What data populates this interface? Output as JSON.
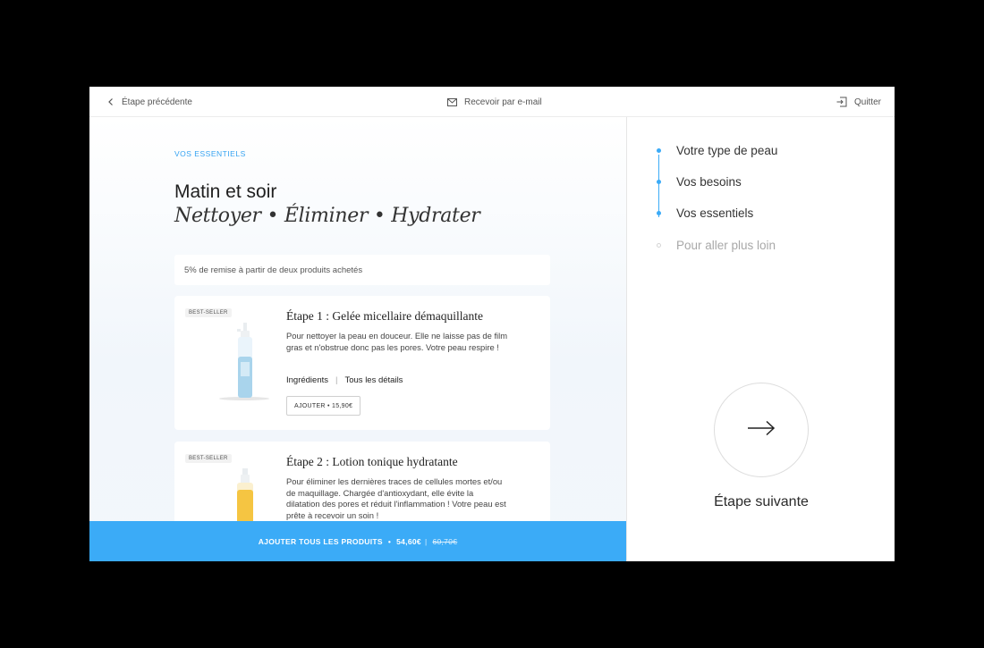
{
  "topbar": {
    "back_label": "Étape précédente",
    "email_label": "Recevoir par e-mail",
    "quit_label": "Quitter"
  },
  "main": {
    "eyebrow": "VOS ESSENTIELS",
    "title": "Matin et soir",
    "subtitle": "Nettoyer • Éliminer • Hydrater",
    "discount_text": "5% de remise à partir de deux produits achetés"
  },
  "products": [
    {
      "badge": "BEST-SELLER",
      "title": "Étape 1 : Gelée micellaire démaquillante",
      "description": "Pour nettoyer la peau en douceur. Elle ne laisse pas de film gras et n'obstrue donc pas les pores. Votre peau respire !",
      "link_ingredients": "Ingrédients",
      "link_details": "Tous les détails",
      "add_label": "AJOUTER • 15,90€",
      "bottle_color": "#a9d4ec"
    },
    {
      "badge": "BEST-SELLER",
      "title": "Étape 2 : Lotion tonique hydratante",
      "description": "Pour éliminer les dernières traces de cellules mortes et/ou de maquillage. Chargée d'antioxydant, elle évite la dilatation des pores et réduit l'inflammation ! Votre peau est prête à recevoir un soin !",
      "bottle_color": "#f5c542"
    }
  ],
  "add_all": {
    "label": "AJOUTER TOUS LES PRODUITS",
    "price": "54,60€",
    "old_price": "60,70€"
  },
  "steps": [
    {
      "label": "Votre type de peau",
      "done": true
    },
    {
      "label": "Vos besoins",
      "done": true
    },
    {
      "label": "Vos essentiels",
      "done": true
    },
    {
      "label": "Pour aller plus loin",
      "done": false
    }
  ],
  "next_label": "Étape suivante",
  "colors": {
    "accent": "#3babf7",
    "background": "#000000"
  }
}
